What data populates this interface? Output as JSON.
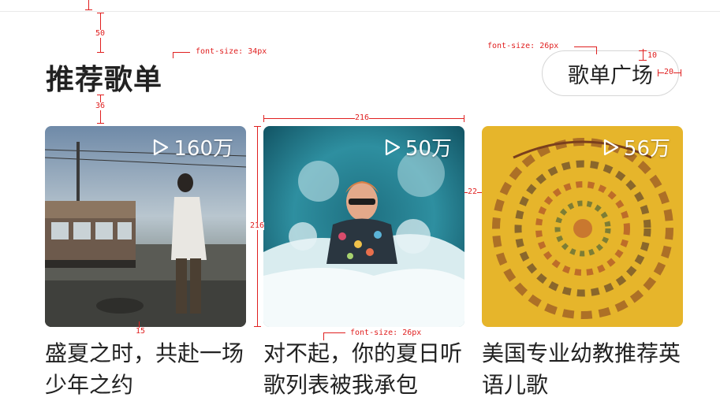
{
  "section": {
    "title": "推荐歌单",
    "plaza_button_label": "歌单广场"
  },
  "playlists": [
    {
      "play_count": "160万",
      "title": "盛夏之时，共赴一场少年之约"
    },
    {
      "play_count": "50万",
      "title": "对不起，你的夏日听歌列表被我承包"
    },
    {
      "play_count": "56万",
      "title": "美国专业幼教推荐英语儿歌"
    }
  ],
  "annotations": {
    "mark_50": "50",
    "mark_36": "36",
    "mark_216_top": "216",
    "mark_216_side": "216",
    "mark_22": "22",
    "mark_15": "15",
    "mark_10": "10",
    "mark_20": "20",
    "font_34": "font-size: 34px",
    "font_26_btn": "font-size: 26px",
    "font_26_title": "font-size: 26px"
  },
  "colors": {
    "annotation": "#e02020",
    "text": "#222222",
    "play_overlay": "#ffffff"
  },
  "cover_art": [
    "beach-train-photo",
    "splash-swimmer-photo",
    "nursery-rhymes-artwork"
  ]
}
